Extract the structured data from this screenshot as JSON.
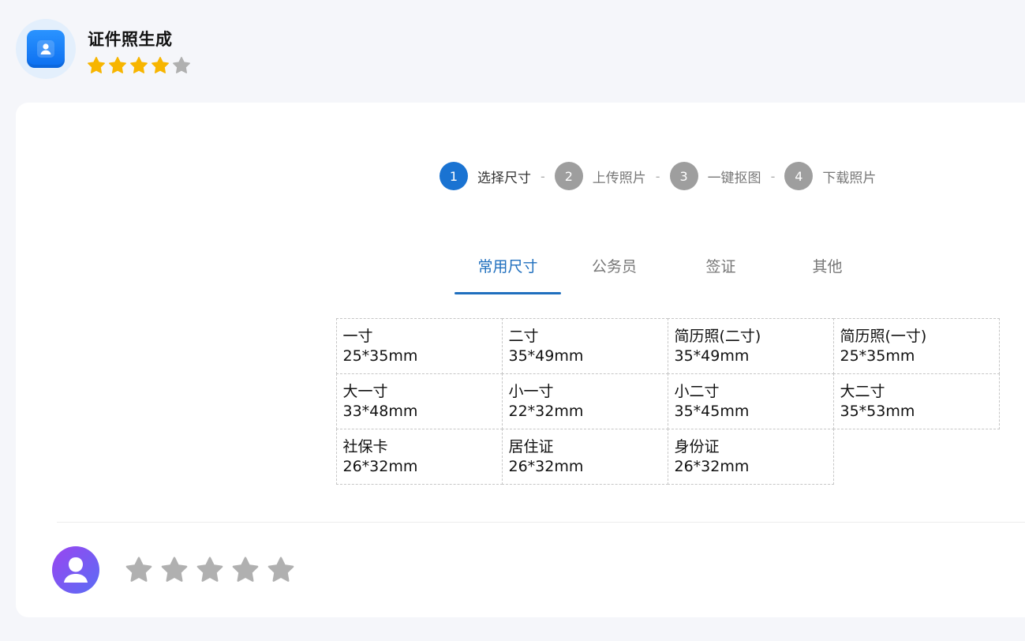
{
  "app": {
    "title": "证件照生成",
    "rating": 4,
    "rating_max": 5,
    "logo_icon": "user-card-icon"
  },
  "steps": [
    {
      "number": "1",
      "label": "选择尺寸",
      "active": true
    },
    {
      "number": "2",
      "label": "上传照片",
      "active": false
    },
    {
      "number": "3",
      "label": "一键抠图",
      "active": false
    },
    {
      "number": "4",
      "label": "下载照片",
      "active": false
    }
  ],
  "step_separator": "-",
  "tabs": [
    {
      "label": "常用尺寸",
      "active": true
    },
    {
      "label": "公务员",
      "active": false
    },
    {
      "label": "签证",
      "active": false
    },
    {
      "label": "其他",
      "active": false
    }
  ],
  "sizes": [
    {
      "name": "一寸",
      "dim": "25*35mm"
    },
    {
      "name": "二寸",
      "dim": "35*49mm"
    },
    {
      "name": "简历照(二寸)",
      "dim": "35*49mm"
    },
    {
      "name": "简历照(一寸)",
      "dim": "25*35mm"
    },
    {
      "name": "大一寸",
      "dim": "33*48mm"
    },
    {
      "name": "小一寸",
      "dim": "22*32mm"
    },
    {
      "name": "小二寸",
      "dim": "35*45mm"
    },
    {
      "name": "大二寸",
      "dim": "35*53mm"
    },
    {
      "name": "社保卡",
      "dim": "26*32mm"
    },
    {
      "name": "居住证",
      "dim": "26*32mm"
    },
    {
      "name": "身份证",
      "dim": "26*32mm"
    }
  ],
  "review": {
    "avatar_icon": "user-avatar-icon",
    "stars": 0,
    "stars_max": 5
  },
  "colors": {
    "accent": "#1a73d2",
    "tab_active": "#1f6fbe",
    "star_filled": "#f7b500",
    "star_empty": "#b0b0b0",
    "step_inactive": "#9e9e9e"
  }
}
